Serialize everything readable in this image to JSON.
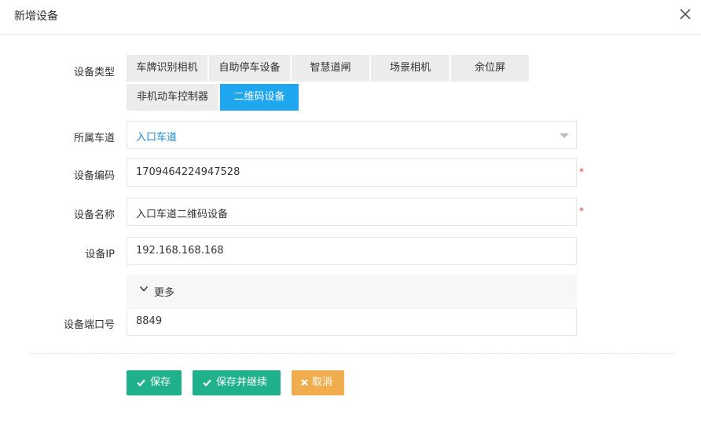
{
  "dialog": {
    "title": "新增设备"
  },
  "form": {
    "type_label": "设备类型",
    "types": [
      "车牌识别相机",
      "自助停车设备",
      "智慧道闸",
      "场景相机",
      "余位屏",
      "非机动车控制器",
      "二维码设备"
    ],
    "selected_type": "二维码设备",
    "lane_label": "所属车道",
    "lane_value": "入口车道",
    "code_label": "设备编码",
    "code_value": "1709464224947528",
    "name_label": "设备名称",
    "name_value": "入口车道二维码设备",
    "ip_label": "设备IP",
    "ip_value": "192.168.168.168",
    "more_label": "更多",
    "port_label": "设备端口号",
    "port_value": "8849",
    "required_mark": "*"
  },
  "actions": {
    "save": "保存",
    "save_continue": "保存并继续",
    "cancel": "取消"
  },
  "colors": {
    "primary": "#1ea6ef",
    "success": "#1fb18c",
    "warning": "#f0ad4e",
    "required": "#e23c3c"
  }
}
